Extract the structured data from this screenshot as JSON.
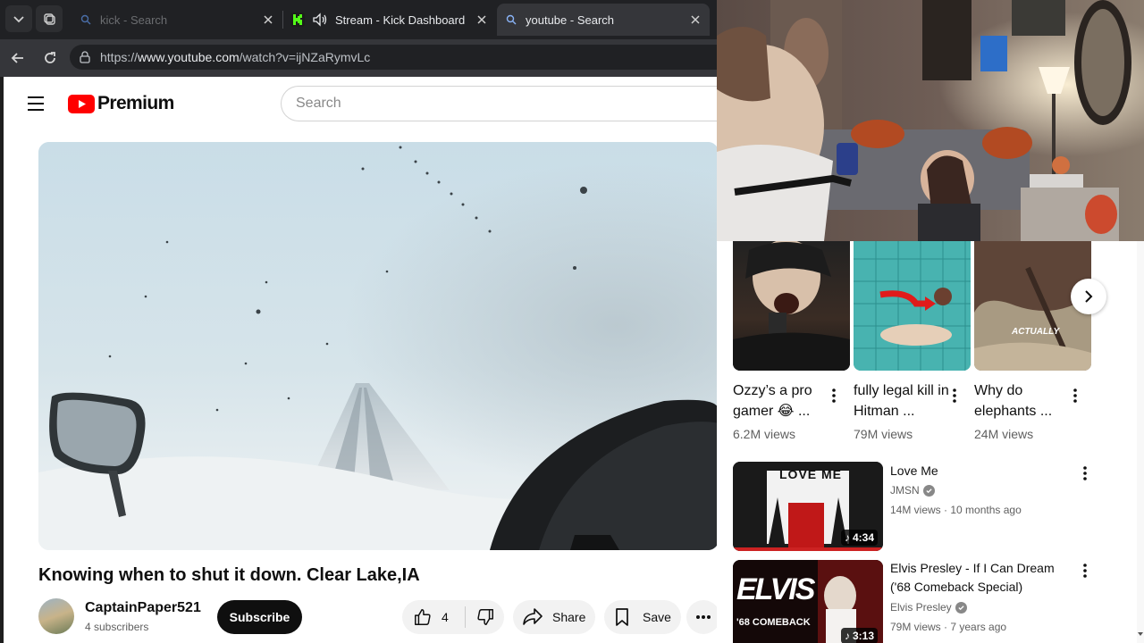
{
  "browser": {
    "tabs": [
      {
        "title": "kick - Search",
        "icon": "search-icon",
        "state": "dim"
      },
      {
        "title": "Stream - Kick Dashboard",
        "icon": "kick-logo",
        "state": "normal"
      },
      {
        "title": "youtube - Search",
        "icon": "search-icon",
        "state": "active"
      }
    ],
    "url_prefix": "https://",
    "url_host": "www.youtube.com",
    "url_path": "/watch?v=ijNZaRymvLc"
  },
  "youtube": {
    "logo_text": "Premium",
    "search_placeholder": "Search",
    "brand_color": "#ff0000"
  },
  "video": {
    "title": "Knowing when to shut it down. Clear Lake,IA",
    "channel": "CaptainPaper521",
    "subscribers": "4 subscribers",
    "subscribe_label": "Subscribe",
    "likes": "4",
    "share_label": "Share",
    "save_label": "Save"
  },
  "shorts": [
    {
      "title": "Ozzy’s a pro gamer 😂 ...",
      "views": "6.2M views"
    },
    {
      "title": "fully legal kill in Hitman ...",
      "views": "79M views"
    },
    {
      "title": "Why do elephants ...",
      "views": "24M views",
      "thumb_text": "ACTUALLY"
    }
  ],
  "recommended": [
    {
      "title": "Love Me",
      "channel": "JMSN",
      "meta": "14M views · 10 months ago",
      "duration": "4:34",
      "thumb_text": "LOVE ME"
    },
    {
      "title": "Elvis Presley - If I Can Dream ('68 Comeback Special)",
      "channel": "Elvis Presley",
      "meta": "79M views · 7 years ago",
      "duration": "3:13",
      "thumb_text": "ELVIS",
      "thumb_sub": "'68 COMEBACK"
    }
  ]
}
